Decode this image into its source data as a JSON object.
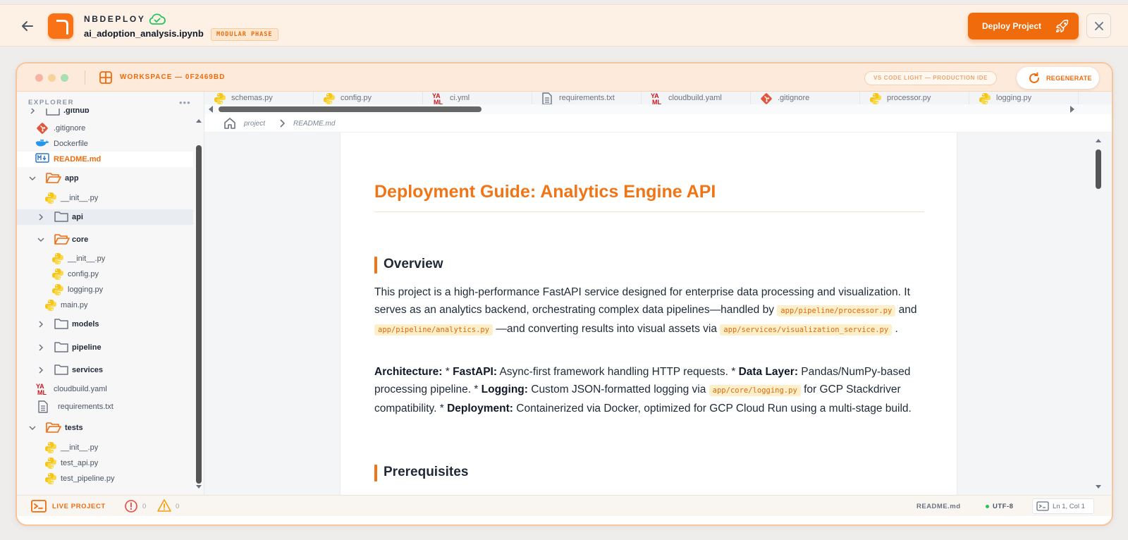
{
  "topbar": {
    "app_name": "NBDEPLOY",
    "file_name": "ai_adoption_analysis.ipynb",
    "phase_badge": "MODULAR PHASE",
    "deploy_label": "Deploy Project",
    "accent_color": "#f06b0c"
  },
  "ide": {
    "workspace_label": "WORKSPACE — 0F2469BD",
    "theme_label": "VS CODE LIGHT — PRODUCTION IDE",
    "regenerate_label": "REGENERATE"
  },
  "explorer": {
    "title": "EXPLORER",
    "more": "•••",
    "items": [
      {
        "label": ".github",
        "type": "folder-closed"
      },
      {
        "label": ".gitignore",
        "type": "git"
      },
      {
        "label": "Dockerfile",
        "type": "docker"
      },
      {
        "label": "README.md",
        "type": "markdown",
        "active": true
      },
      {
        "label": "app",
        "type": "folder-open"
      },
      {
        "label": "__init__.py",
        "type": "python"
      },
      {
        "label": "api",
        "type": "folder-closed",
        "hover": true
      },
      {
        "label": "core",
        "type": "folder-open"
      },
      {
        "label": "__init__.py",
        "type": "python"
      },
      {
        "label": "config.py",
        "type": "python"
      },
      {
        "label": "logging.py",
        "type": "python"
      },
      {
        "label": "main.py",
        "type": "python"
      },
      {
        "label": "models",
        "type": "folder-closed"
      },
      {
        "label": "pipeline",
        "type": "folder-closed"
      },
      {
        "label": "services",
        "type": "folder-closed"
      },
      {
        "label": "cloudbuild.yaml",
        "type": "yaml"
      },
      {
        "label": "requirements.txt",
        "type": "text"
      },
      {
        "label": "tests",
        "type": "folder-open"
      },
      {
        "label": "__init__.py",
        "type": "python"
      },
      {
        "label": "test_api.py",
        "type": "python"
      },
      {
        "label": "test_pipeline.py",
        "type": "python"
      }
    ]
  },
  "tabs": [
    {
      "label": "schemas.py",
      "type": "python"
    },
    {
      "label": "config.py",
      "type": "python"
    },
    {
      "label": "ci.yml",
      "type": "yaml"
    },
    {
      "label": "requirements.txt",
      "type": "text"
    },
    {
      "label": "cloudbuild.yaml",
      "type": "yaml"
    },
    {
      "label": ".gitignore",
      "type": "git"
    },
    {
      "label": "processor.py",
      "type": "python"
    },
    {
      "label": "logging.py",
      "type": "python"
    }
  ],
  "breadcrumb": {
    "root": "project",
    "file": "README.md"
  },
  "document": {
    "title": "Deployment Guide: Analytics Engine API",
    "overview_heading": "Overview",
    "overview": {
      "t1": "This project is a high-performance FastAPI service designed for enterprise data processing and visualization. It serves as an analytics backend, orchestrating complex data pipelines—handled by ",
      "code1": "app/pipeline/processor.py",
      "t2": " and ",
      "code2": "app/pipeline/analytics.py",
      "t3": " —and converting results into visual assets via ",
      "code3": "app/services/visualization_service.py",
      "t4": " ."
    },
    "architecture": {
      "b1": "Architecture:",
      "t1": " * ",
      "b2": "FastAPI:",
      "t2": " Async-first framework handling HTTP requests. * ",
      "b3": "Data Layer:",
      "t3": " Pandas/NumPy-based processing pipeline. * ",
      "b4": "Logging:",
      "t4": " Custom JSON-formatted logging via ",
      "code1": "app/core/logging.py",
      "t5": "  for GCP Stackdriver compatibility. * ",
      "b5": "Deployment:",
      "t6": " Containerized via Docker, optimized for GCP Cloud Run using a multi-stage build."
    },
    "prereq_heading": "Prerequisites"
  },
  "statusbar": {
    "live_label": "LIVE PROJECT",
    "errors": "0",
    "warnings": "0",
    "file": "README.md",
    "encoding": "UTF-8",
    "position": "Ln 1, Col 1"
  }
}
